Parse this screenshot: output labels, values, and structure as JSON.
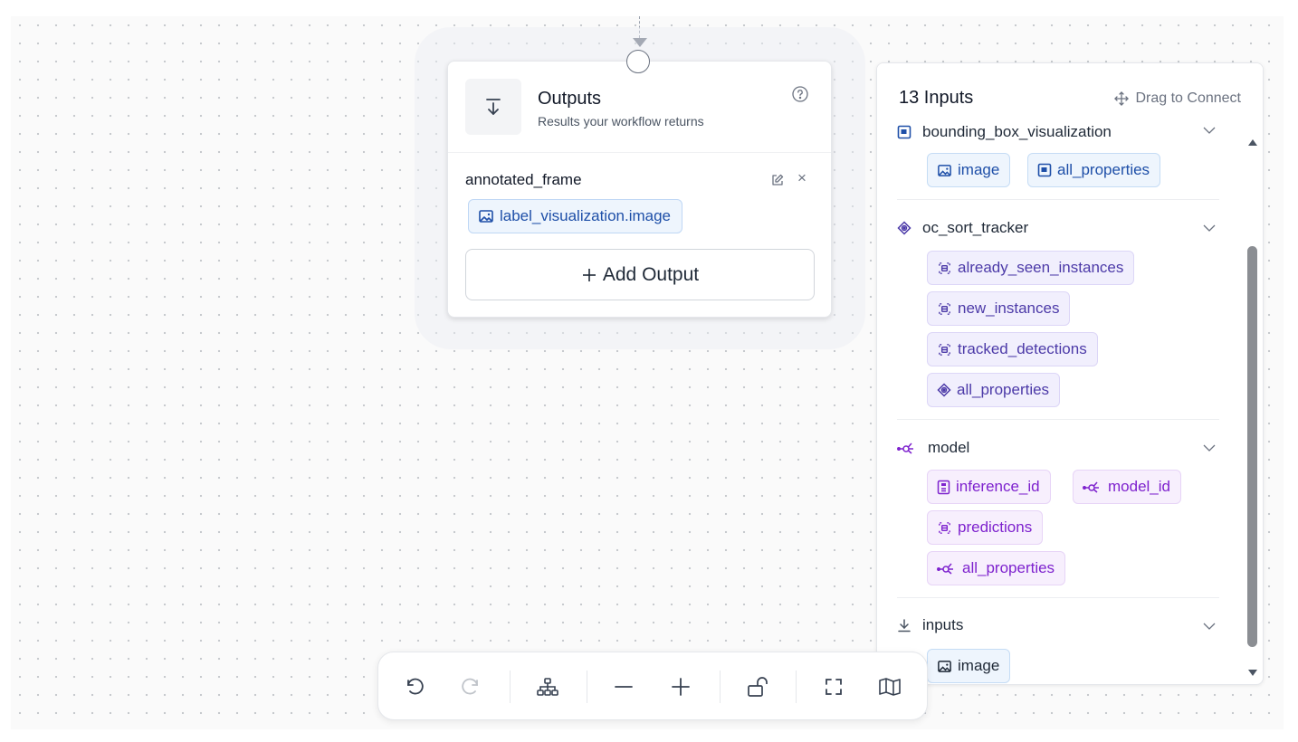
{
  "outputs_node": {
    "title": "Outputs",
    "subtitle": "Results your workflow returns",
    "icon": "arrow-down-to-line-icon",
    "output_name": "annotated_frame",
    "output_chip": "label_visualization.image",
    "add_label": "Add Output"
  },
  "inputs_panel": {
    "title": "13 Inputs",
    "drag_label": "Drag to Connect",
    "groups": [
      {
        "name": "bounding_box_visualization",
        "icon": "bounding-box-icon",
        "chips": [
          {
            "label": "image",
            "icon": "image-icon"
          },
          {
            "label": "all_properties",
            "icon": "bounding-box-icon"
          }
        ]
      },
      {
        "name": "oc_sort_tracker",
        "icon": "tracker-icon",
        "chips": [
          {
            "label": "already_seen_instances",
            "icon": "detections-icon"
          },
          {
            "label": "new_instances",
            "icon": "detections-icon"
          },
          {
            "label": "tracked_detections",
            "icon": "detections-icon"
          },
          {
            "label": "all_properties",
            "icon": "tracker-icon"
          }
        ]
      },
      {
        "name": "model",
        "icon": "model-icon",
        "chips": [
          {
            "label": "inference_id",
            "icon": "id-icon"
          },
          {
            "label": "model_id",
            "icon": "model-icon"
          },
          {
            "label": "predictions",
            "icon": "detections-icon"
          },
          {
            "label": "all_properties",
            "icon": "model-icon"
          }
        ]
      },
      {
        "name": "inputs",
        "icon": "download-icon",
        "chips": [
          {
            "label": "image",
            "icon": "image-icon"
          }
        ]
      }
    ]
  },
  "toolbar": {
    "buttons": [
      "undo-icon",
      "redo-icon",
      "auto-layout-icon",
      "zoom-out-icon",
      "zoom-in-icon",
      "unlock-icon",
      "fit-view-icon",
      "minimap-icon"
    ]
  },
  "colors": {
    "chip_blue": "#eef5fd",
    "chip_violet": "#f1effd",
    "chip_purple": "#f7effd",
    "text_blue": "#1e4fa8",
    "text_violet": "#4c3aa8",
    "text_purple": "#7e22ce"
  }
}
